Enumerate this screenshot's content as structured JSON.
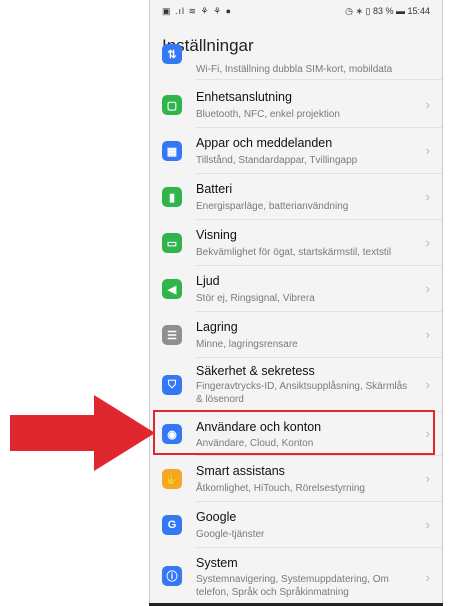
{
  "status_bar": {
    "left": "▣ .ıl ≋ ⚘ ⚘ ●",
    "right": "◷ ∗ ▯ 83 % ▬ 15:44"
  },
  "header": {
    "title": "Inställningar"
  },
  "rows": [
    {
      "label": "",
      "sub": "Wi-Fi, Inställning dubbla SIM-kort, mobildata",
      "icon": "network-icon",
      "color": "#3478f6"
    },
    {
      "label": "Enhetsanslutning",
      "sub": "Bluetooth, NFC, enkel projektion",
      "icon": "device-connection-icon",
      "color": "#2fb54b"
    },
    {
      "label": "Appar och meddelanden",
      "sub": "Tillstånd, Standardappar, Tvillingapp",
      "icon": "apps-icon",
      "color": "#3478f6"
    },
    {
      "label": "Batteri",
      "sub": "Energisparläge, batterianvändning",
      "icon": "battery-icon",
      "color": "#2fb54b"
    },
    {
      "label": "Visning",
      "sub": "Bekvämlighet för ögat, startskärmstil, textstil",
      "icon": "display-icon",
      "color": "#2fb54b"
    },
    {
      "label": "Ljud",
      "sub": "Stör ej, Ringsignal, Vibrera",
      "icon": "sound-icon",
      "color": "#2fb54b"
    },
    {
      "label": "Lagring",
      "sub": "Minne, lagringsrensare",
      "icon": "storage-icon",
      "color": "#8e8e93"
    },
    {
      "label": "Säkerhet & sekretess",
      "sub": "Fingeravtrycks-ID, Ansiktsupplåsning, Skärmlås & lösenord",
      "icon": "security-icon",
      "color": "#3478f6"
    },
    {
      "label": "Användare och konton",
      "sub": "Användare, Cloud, Konton",
      "icon": "users-icon",
      "color": "#3478f6"
    },
    {
      "label": "Smart assistans",
      "sub": "Åtkomlighet, HiTouch, Rörelsestyrning",
      "icon": "hand-icon",
      "color": "#f5a623"
    },
    {
      "label": "Google",
      "sub": "Google-tjänster",
      "icon": "google-icon",
      "color": "#3478f6"
    },
    {
      "label": "System",
      "sub": "Systemnavigering, Systemuppdatering, Om telefon, Språk och Språkinmatning",
      "icon": "system-icon",
      "color": "#3478f6"
    }
  ],
  "annotation": {
    "highlight_color": "#e0262f",
    "arrow_color": "#e0262f"
  }
}
